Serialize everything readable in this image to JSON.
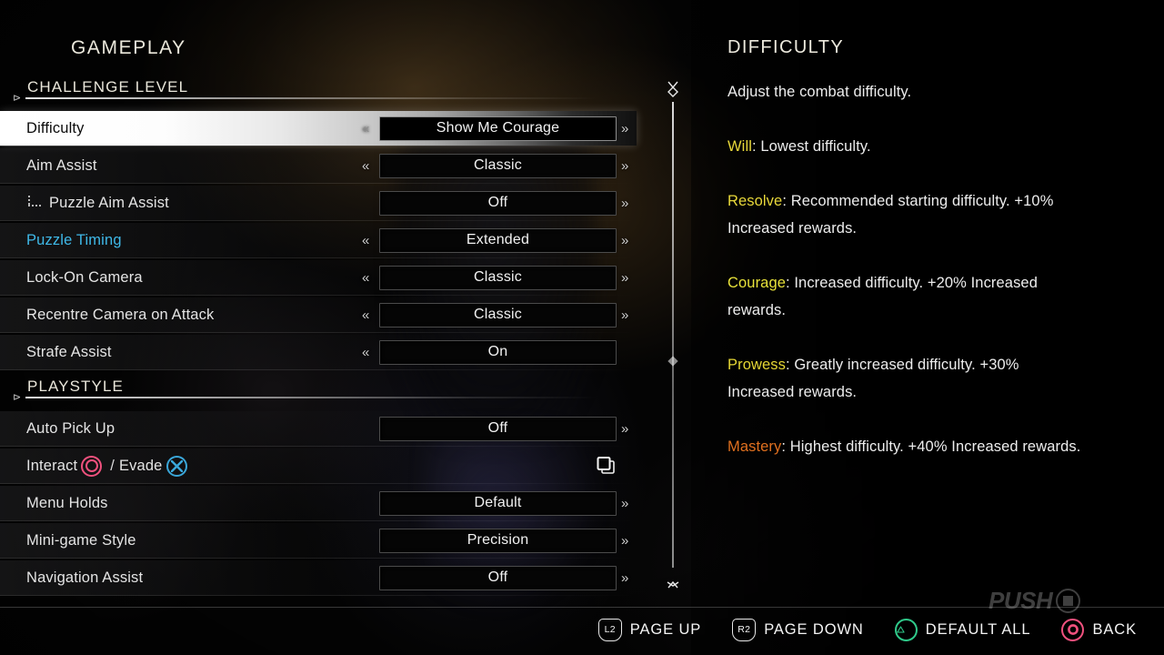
{
  "pane": {
    "title": "GAMEPLAY"
  },
  "sections": [
    {
      "id": "challenge-level",
      "label": "CHALLENGE LEVEL",
      "rows": [
        {
          "label": "Difficulty",
          "value": "Show Me Courage",
          "left_arrow": "«",
          "right_arrow": "»",
          "has_left": true,
          "has_right": true,
          "selected": true,
          "indent": false,
          "state": "selected"
        },
        {
          "label": "Aim Assist",
          "value": "Classic",
          "left_arrow": "«",
          "right_arrow": "»",
          "has_left": true,
          "has_right": true,
          "selected": false,
          "indent": false,
          "state": "normal"
        },
        {
          "label": "Puzzle Aim Assist",
          "value": "Off",
          "left_arrow": "«",
          "right_arrow": "»",
          "has_left": false,
          "has_right": true,
          "selected": false,
          "indent": true,
          "state": "normal"
        },
        {
          "label": "Puzzle Timing",
          "value": "Extended",
          "left_arrow": "«",
          "right_arrow": "»",
          "has_left": true,
          "has_right": true,
          "selected": false,
          "indent": false,
          "state": "changed"
        },
        {
          "label": "Lock-On Camera",
          "value": "Classic",
          "left_arrow": "«",
          "right_arrow": "»",
          "has_left": true,
          "has_right": true,
          "selected": false,
          "indent": false,
          "state": "normal"
        },
        {
          "label": "Recentre Camera on Attack",
          "value": "Classic",
          "left_arrow": "«",
          "right_arrow": "»",
          "has_left": true,
          "has_right": true,
          "selected": false,
          "indent": false,
          "state": "normal"
        },
        {
          "label": "Strafe Assist",
          "value": "On",
          "left_arrow": "«",
          "right_arrow": "»",
          "has_left": true,
          "has_right": false,
          "selected": false,
          "indent": false,
          "state": "normal"
        }
      ]
    },
    {
      "id": "playstyle",
      "label": "PLAYSTYLE",
      "rows": [
        {
          "label": "Auto Pick Up",
          "value": "Off",
          "left_arrow": "«",
          "right_arrow": "»",
          "has_left": false,
          "has_right": true,
          "selected": false,
          "indent": false,
          "state": "normal"
        },
        {
          "label": "Interact",
          "label_2": "/",
          "label_3": "Evade",
          "value": "",
          "glyph_row": true,
          "glyphs": [
            "circle-button-icon",
            "cross-button-icon"
          ],
          "action_icon": "swap-icon",
          "left_arrow": "«",
          "right_arrow": "»",
          "has_left": false,
          "has_right": false,
          "selected": false,
          "indent": false,
          "state": "normal"
        },
        {
          "label": "Menu Holds",
          "value": "Default",
          "left_arrow": "«",
          "right_arrow": "»",
          "has_left": false,
          "has_right": true,
          "selected": false,
          "indent": false,
          "state": "normal"
        },
        {
          "label": "Mini-game Style",
          "value": "Precision",
          "left_arrow": "«",
          "right_arrow": "»",
          "has_left": false,
          "has_right": true,
          "selected": false,
          "indent": false,
          "state": "normal"
        },
        {
          "label": "Navigation Assist",
          "value": "Off",
          "left_arrow": "«",
          "right_arrow": "»",
          "has_left": false,
          "has_right": true,
          "selected": false,
          "indent": false,
          "state": "normal"
        }
      ]
    }
  ],
  "detail": {
    "title": "DIFFICULTY",
    "intro": "Adjust the combat difficulty.",
    "entries": [
      {
        "term": "Will",
        "separator": ": ",
        "text": "Lowest difficulty.",
        "color": "#e8d83a"
      },
      {
        "term": "Resolve",
        "separator": ": ",
        "text": "Recommended starting difficulty. +10% Increased rewards.",
        "color": "#e8d83a"
      },
      {
        "term": "Courage",
        "separator": ": ",
        "text": "Increased difficulty. +20% Increased rewards.",
        "color": "#e8e23a"
      },
      {
        "term": "Prowess",
        "separator": ": ",
        "text": "Greatly increased difficulty. +30% Increased rewards.",
        "color": "#e5d634"
      },
      {
        "term": "Mastery",
        "separator": ": ",
        "text": "Highest difficulty. +40% Increased rewards.",
        "color": "#e0701f"
      }
    ]
  },
  "prompts": [
    {
      "glyph": "l2-trigger-icon",
      "glyph_text": "L2",
      "label": "PAGE UP"
    },
    {
      "glyph": "r2-trigger-icon",
      "glyph_text": "R2",
      "label": "PAGE DOWN"
    },
    {
      "glyph": "triangle-button-icon",
      "glyph_text": "",
      "label": "DEFAULT ALL"
    },
    {
      "glyph": "circle-button-icon",
      "glyph_text": "",
      "label": "BACK"
    }
  ],
  "watermark": {
    "text": "PUSH"
  },
  "colors": {
    "accent_highlight": "#3fb9e8",
    "difficulty_yellow": "#e8d83a",
    "difficulty_orange": "#e0701f",
    "ps_circle": "#f0517e",
    "ps_cross": "#3aa6d8",
    "ps_triangle": "#2fc98a"
  }
}
